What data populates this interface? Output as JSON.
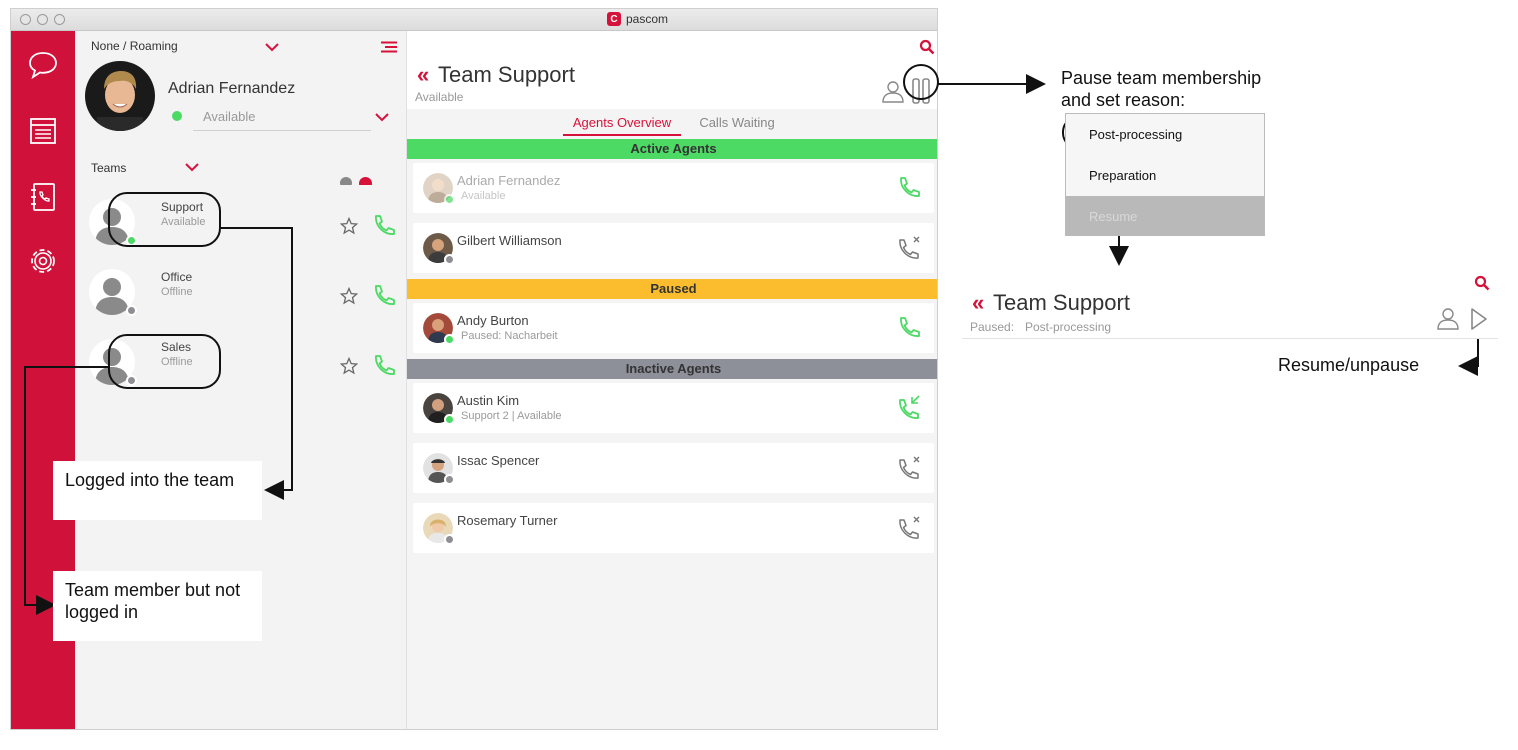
{
  "window": {
    "title": "pascom",
    "logo_letter": "C"
  },
  "nav": {
    "items": [
      "chat-icon",
      "journal-icon",
      "phonebook-icon",
      "settings-icon"
    ]
  },
  "profile": {
    "location": "None / Roaming",
    "name": "Adrian Fernandez",
    "status": "Available",
    "status_color": "#4cd964"
  },
  "teams": {
    "header": "Teams",
    "items": [
      {
        "name": "Support",
        "status": "Available",
        "status_color": "#4cd964"
      },
      {
        "name": "Office",
        "status": "Offline",
        "status_color": "#8e8e93"
      },
      {
        "name": "Sales",
        "status": "Offline",
        "status_color": "#8e8e93"
      }
    ]
  },
  "team_view": {
    "title": "Team Support",
    "subtitle": "Available",
    "tabs": [
      "Agents Overview",
      "Calls Waiting"
    ],
    "active_tab": "Agents Overview",
    "sections": {
      "active": {
        "label": "Active Agents",
        "color": "#4cd964"
      },
      "paused": {
        "label": "Paused",
        "color": "#fbbd2e"
      },
      "inactive": {
        "label": "Inactive Agents",
        "color": "#8e9099"
      }
    },
    "agents": [
      {
        "name": "Adrian Fernandez",
        "sub": "Available",
        "action": "call",
        "dimmed": true,
        "status_color": "#4cd964"
      },
      {
        "name": "Gilbert Williamson",
        "sub": "",
        "action": "call-disabled",
        "dimmed": false,
        "status_color": "#8e8e93"
      },
      {
        "name": "Andy Burton",
        "sub": "Paused: Nacharbeit",
        "action": "call",
        "dimmed": false,
        "status_color": "#4cd964"
      },
      {
        "name": "Austin Kim",
        "sub": "Support 2 |  Available",
        "action": "callback",
        "dimmed": false,
        "status_color": "#4cd964"
      },
      {
        "name": "Issac Spencer",
        "sub": "",
        "action": "call-disabled",
        "dimmed": false,
        "status_color": "#8e8e93"
      },
      {
        "name": "Rosemary Turner",
        "sub": "",
        "action": "call-disabled",
        "dimmed": false,
        "status_color": "#8e8e93"
      }
    ]
  },
  "annotations": {
    "logged_in": "Logged into the team",
    "not_logged_in": "Team member but not logged in",
    "pause_line1": "Pause team membership",
    "pause_line2": "and set reason:",
    "resume": "Resume/unpause"
  },
  "pause_menu": {
    "items": [
      "Post-processing",
      "Preparation",
      "Resume"
    ]
  },
  "paused_header": {
    "title": "Team Support",
    "status_label": "Paused:",
    "reason": "Post-processing"
  },
  "colors": {
    "brand_red": "#d0113a",
    "accent_red": "#d6123a",
    "green": "#4cd964"
  }
}
